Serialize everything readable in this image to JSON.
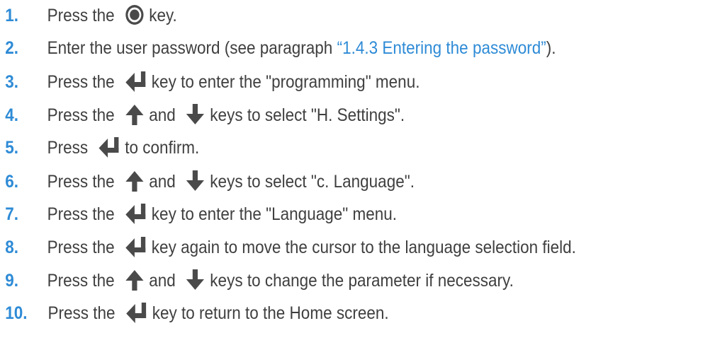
{
  "steps": [
    {
      "number": "1.",
      "parts": [
        {
          "t": "text",
          "v": "Press the "
        },
        {
          "t": "icon",
          "name": "ok-button-icon"
        },
        {
          "t": "text",
          "v": "key."
        }
      ]
    },
    {
      "number": "2.",
      "parts": [
        {
          "t": "text",
          "v": "Enter the user password (see paragraph "
        },
        {
          "t": "link",
          "v": "“1.4.3 Entering the password”"
        },
        {
          "t": "text",
          "v": ")."
        }
      ]
    },
    {
      "number": "3.",
      "parts": [
        {
          "t": "text",
          "v": "Press the "
        },
        {
          "t": "icon",
          "name": "enter-key-icon"
        },
        {
          "t": "text",
          "v": "key to enter the \"programming\" menu."
        }
      ]
    },
    {
      "number": "4.",
      "parts": [
        {
          "t": "text",
          "v": "Press the "
        },
        {
          "t": "icon",
          "name": "arrow-up-icon"
        },
        {
          "t": "text",
          "v": "and "
        },
        {
          "t": "icon",
          "name": "arrow-down-icon"
        },
        {
          "t": "text",
          "v": "keys to select \"H. Settings\"."
        }
      ]
    },
    {
      "number": "5.",
      "parts": [
        {
          "t": "text",
          "v": "Press "
        },
        {
          "t": "icon",
          "name": "enter-key-icon"
        },
        {
          "t": "text",
          "v": "to confirm."
        }
      ]
    },
    {
      "number": "6.",
      "parts": [
        {
          "t": "text",
          "v": "Press the "
        },
        {
          "t": "icon",
          "name": "arrow-up-icon"
        },
        {
          "t": "text",
          "v": "and "
        },
        {
          "t": "icon",
          "name": "arrow-down-icon"
        },
        {
          "t": "text",
          "v": "keys to select \"c. Language\"."
        }
      ]
    },
    {
      "number": "7.",
      "parts": [
        {
          "t": "text",
          "v": "Press the "
        },
        {
          "t": "icon",
          "name": "enter-key-icon"
        },
        {
          "t": "text",
          "v": "key to enter the \"Language\" menu."
        }
      ]
    },
    {
      "number": "8.",
      "parts": [
        {
          "t": "text",
          "v": "Press the "
        },
        {
          "t": "icon",
          "name": "enter-key-icon"
        },
        {
          "t": "text",
          "v": "key again to move the cursor to the language selection field."
        }
      ]
    },
    {
      "number": "9.",
      "parts": [
        {
          "t": "text",
          "v": "Press the "
        },
        {
          "t": "icon",
          "name": "arrow-up-icon"
        },
        {
          "t": "text",
          "v": "and "
        },
        {
          "t": "icon",
          "name": "arrow-down-icon"
        },
        {
          "t": "text",
          "v": "keys to change the parameter if necessary."
        }
      ]
    },
    {
      "number": "10.",
      "parts": [
        {
          "t": "text",
          "v": "Press the "
        },
        {
          "t": "icon",
          "name": "enter-key-icon"
        },
        {
          "t": "text",
          "v": "key to return to the Home screen."
        }
      ]
    }
  ],
  "colors": {
    "number": "#2e8bd6",
    "link": "#2e8bd6",
    "text": "#3f3f3f",
    "icon": "#4a4a4a"
  }
}
